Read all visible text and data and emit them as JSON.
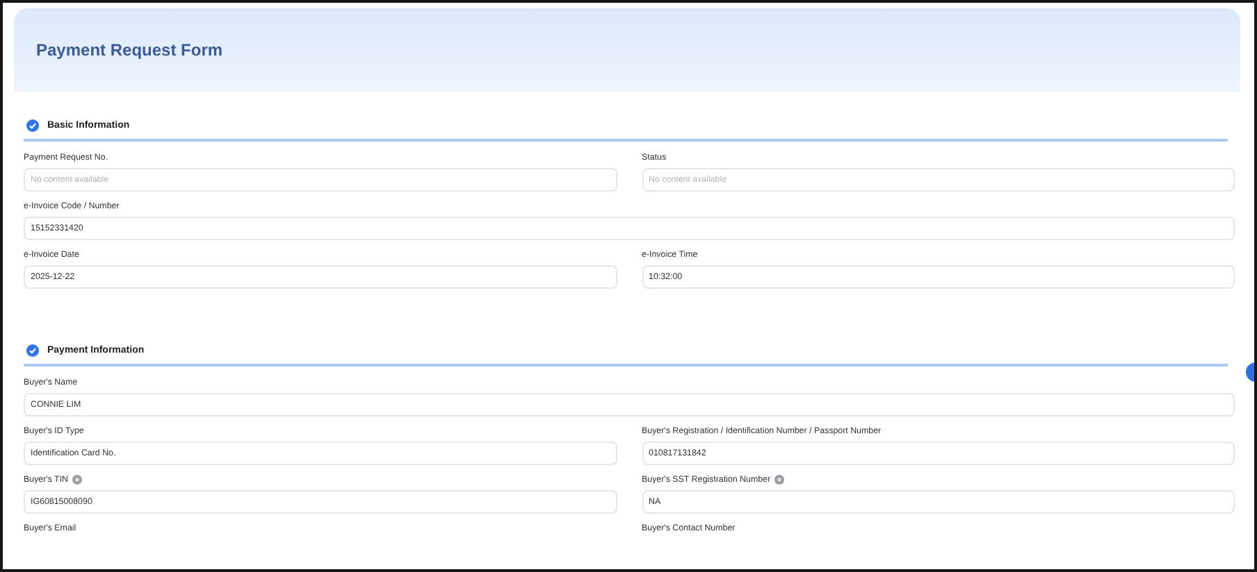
{
  "header": {
    "title": "Payment Request Form"
  },
  "sections": [
    {
      "title": "Basic Information",
      "rows": [
        [
          {
            "label": "Payment Request No.",
            "placeholder": "No content available",
            "help": false
          },
          {
            "label": "Status",
            "placeholder": "No content available",
            "help": false
          }
        ],
        [
          {
            "label": "e-Invoice Code / Number",
            "value": "15152331420",
            "help": false
          }
        ],
        [
          {
            "label": "e-Invoice Date",
            "value": "2025-12-22",
            "help": false
          },
          {
            "label": "e-Invoice Time",
            "value": "10:32:00",
            "help": false
          }
        ]
      ]
    },
    {
      "title": "Payment Information",
      "rows": [
        [
          {
            "label": "Buyer's Name",
            "value": "CONNIE LIM",
            "help": false
          }
        ],
        [
          {
            "label": "Buyer's ID Type",
            "value": "Identification Card No.",
            "help": false
          },
          {
            "label": "Buyer's Registration / Identification Number / Passport Number",
            "value": "010817131842",
            "help": false
          }
        ],
        [
          {
            "label": "Buyer's TIN",
            "value": "IG60815008090",
            "help": true
          },
          {
            "label": "Buyer's SST Registration Number",
            "value": "NA",
            "help": true
          }
        ],
        [
          {
            "label": "Buyer's Email",
            "help": false
          },
          {
            "label": "Buyer's Contact Number",
            "help": false
          }
        ]
      ]
    }
  ]
}
